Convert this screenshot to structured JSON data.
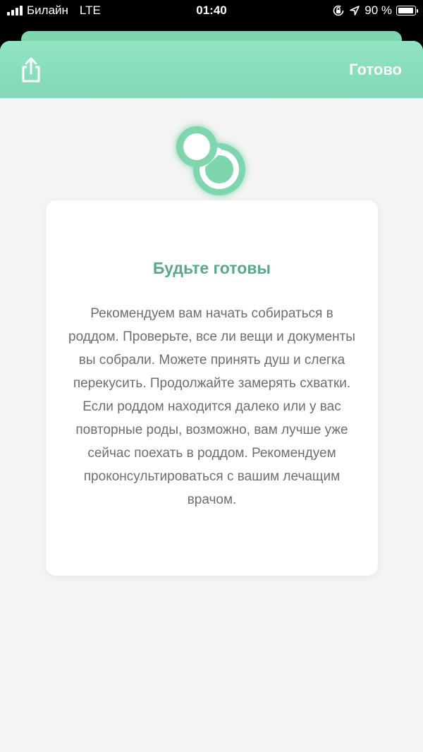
{
  "status_bar": {
    "carrier": "Билайн",
    "network": "LTE",
    "time": "01:40",
    "battery": "90 %",
    "battery_level": 0.9,
    "icons": [
      "signal-icon",
      "orientation-lock-icon",
      "location-arrow-icon",
      "battery-icon"
    ]
  },
  "header": {
    "done_label": "Готово",
    "share_icon": "share-icon",
    "accent_color": "#8ee0c0"
  },
  "card": {
    "icon": "pacifier-icon",
    "title": "Будьте готовы",
    "text": "Рекомендуем вам начать собираться в роддом. Проверьте, все ли вещи и документы вы собрали. Можете принять душ и слегка перекусить. Продолжайте замерять схватки. Если роддом находится далеко или у вас повторные роды, возможно, вам лучше уже сейчас поехать в роддом. Рекомендуем проконсультироваться с вашим лечащим врачом.",
    "title_color": "#5aa78c"
  }
}
